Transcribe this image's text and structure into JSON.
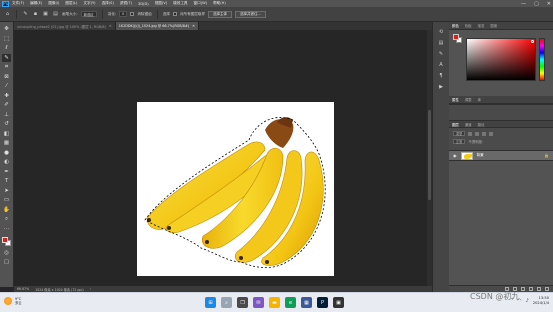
{
  "app": {
    "logo": "Ps"
  },
  "menubar": {
    "items": [
      "文件(F)",
      "编辑(E)",
      "图像(I)",
      "图层(L)",
      "文字(Y)",
      "选择(S)",
      "滤镜(T)",
      "3D(D)",
      "视图(V)",
      "增效工具",
      "窗口(W)",
      "帮助(H)"
    ]
  },
  "window_controls": {
    "minimize": "—",
    "restore": "▢",
    "close": "✕"
  },
  "options": {
    "brush_size_label": "画笔大小:",
    "mode_value": "新选区",
    "feather_label": "羽化:",
    "feather_value": "0",
    "antialias_label": "消除锯齿",
    "sample_label": "选择",
    "auto_enhance_label": "对所有图层取样",
    "select_subject_label": "选择主体",
    "select_mask_label": "选择并遮住..."
  },
  "tabs": [
    {
      "label": "uncoupling_phase2 (01).jpg @ 100% (图层 1, RGB/8)",
      "active": false
    },
    {
      "label": "1K2DDK(J)(J)_1024.jpg @ 66.7%(RGB/8#)",
      "active": true
    }
  ],
  "statusbar": {
    "zoom": "66.67%",
    "size": "1024 像素 x 1024 像素 (72 ppi)"
  },
  "panels": {
    "color_tabs": [
      "颜色",
      "色板",
      "渐变",
      "图案"
    ],
    "props_tabs": [
      "属性",
      "调整",
      "库"
    ],
    "layers_tabs": [
      "图层",
      "通道",
      "路径"
    ],
    "kind_filter": "类型",
    "blend_mode": "正常",
    "opacity_label": "不透明度:",
    "layer_name": "背景"
  },
  "taskbar": {
    "weather_temp": "9°C",
    "weather_desc": "多云",
    "time": "13:50",
    "date": "2024/1/4",
    "watermark": "CSDN @初九"
  },
  "colors": {
    "foreground": "#e31b1b",
    "background": "#ffffff",
    "accent": "#31a8ff"
  }
}
